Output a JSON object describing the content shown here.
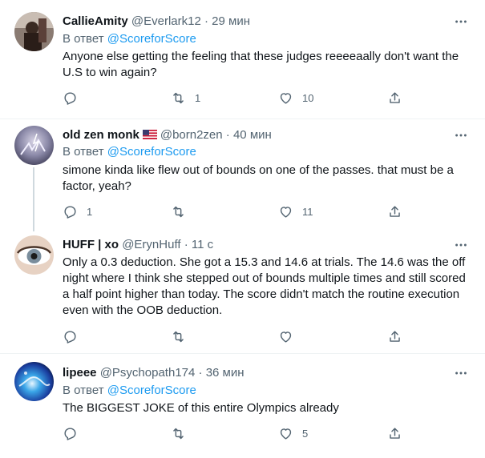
{
  "tweets": [
    {
      "name": "CallieAmity",
      "handle": "@Everlark12",
      "time": "29 мин",
      "reply_prefix": "В ответ",
      "reply_target": "@ScoreforScore",
      "text": "Anyone else getting the feeling that these judges reeeeaally don't want the U.S to win again?",
      "replies": "",
      "retweets": "1",
      "likes": "10"
    },
    {
      "name": "old zen monk",
      "handle": "@born2zen",
      "time": "40 мин",
      "reply_prefix": "В ответ",
      "reply_target": "@ScoreforScore",
      "text": "simone kinda like flew out of bounds on one of the passes. that must be a factor, yeah?",
      "replies": "1",
      "retweets": "",
      "likes": "11"
    },
    {
      "name": "HUFF | xo",
      "handle": "@ErynHuff",
      "time": "11 с",
      "text": "Only a 0.3 deduction. She got a 15.3 and 14.6 at trials. The 14.6 was the off night where I think she stepped out of bounds multiple times and still scored a half point higher than today. The score didn't match the routine execution even with the OOB deduction.",
      "replies": "",
      "retweets": "",
      "likes": ""
    },
    {
      "name": "lipeee",
      "handle": "@Psychopath174",
      "time": "36 мин",
      "reply_prefix": "В ответ",
      "reply_target": "@ScoreforScore",
      "text": "The BIGGEST JOKE of this entire Olympics already",
      "replies": "",
      "retweets": "",
      "likes": "5"
    }
  ],
  "sep": "·",
  "colors": {
    "accent": "#1d9bf0",
    "muted": "#536471",
    "text": "#0f1419"
  }
}
